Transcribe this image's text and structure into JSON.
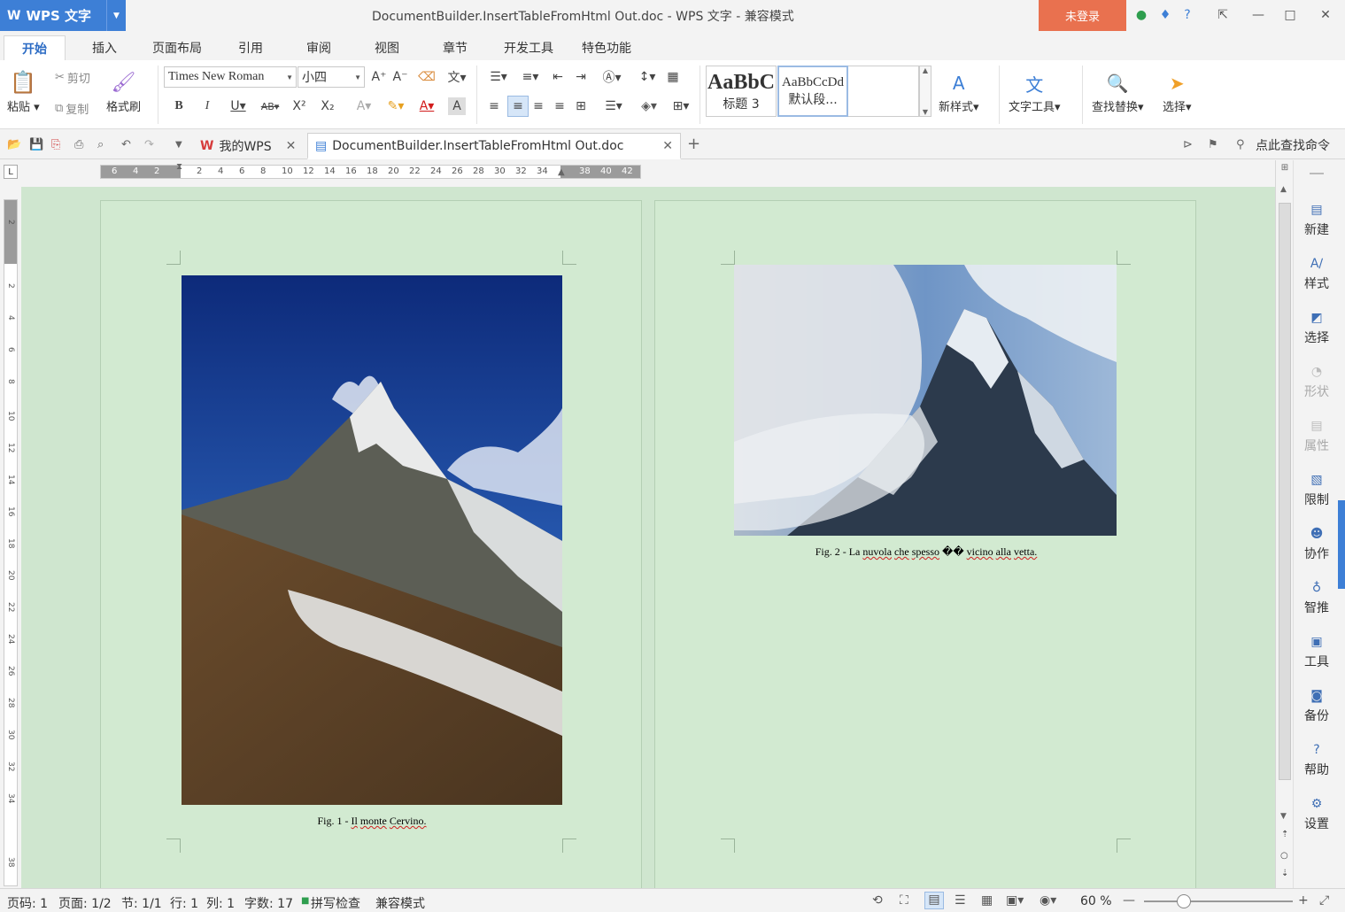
{
  "titlebar": {
    "app_name": "WPS 文字",
    "window_title": "DocumentBuilder.InsertTableFromHtml Out.doc - WPS 文字 - 兼容模式",
    "login_label": "未登录"
  },
  "menu": {
    "tabs": [
      "开始",
      "插入",
      "页面布局",
      "引用",
      "审阅",
      "视图",
      "章节",
      "开发工具",
      "特色功能"
    ],
    "active": "开始"
  },
  "ribbon": {
    "paste": "粘贴",
    "cut": "剪切",
    "copy": "复制",
    "format_painter": "格式刷",
    "font_name": "Times New Roman",
    "font_size": "小四",
    "style_heading_sample": "AaBbC",
    "style_heading_name": "标题 3",
    "style_default_sample": "AaBbCcDd",
    "style_default_name": "默认段...",
    "new_style": "新样式",
    "text_tools": "文字工具",
    "find_replace": "查找替换",
    "select": "选择"
  },
  "tabbar": {
    "home_tab": "我的WPS",
    "doc_tab": "DocumentBuilder.InsertTableFromHtml Out.doc",
    "search_cmd": "点此查找命令"
  },
  "hruler_ticks": [
    "6",
    "4",
    "2",
    "",
    "2",
    "4",
    "6",
    "8",
    "10",
    "12",
    "14",
    "16",
    "18",
    "20",
    "22",
    "24",
    "26",
    "28",
    "30",
    "32",
    "34",
    "",
    "38",
    "40",
    "42"
  ],
  "vruler_ticks": [
    "2",
    "",
    "2",
    "4",
    "6",
    "8",
    "10",
    "12",
    "14",
    "16",
    "18",
    "20",
    "22",
    "24",
    "26",
    "28",
    "30",
    "32",
    "34",
    "",
    "38"
  ],
  "pages": [
    {
      "caption_prefix": "Fig. 1 - ",
      "caption_words": [
        "Il",
        "monte",
        "Cervino."
      ]
    },
    {
      "caption_prefix": "Fig. 2 - ",
      "caption_words": [
        "La",
        "nuvola",
        "che",
        "spesso",
        "��",
        "vicino",
        "alla",
        "vetta."
      ]
    }
  ],
  "sidepanel": [
    {
      "label": "新建",
      "icon": "new-doc-icon",
      "enabled": true
    },
    {
      "label": "样式",
      "icon": "style-icon",
      "enabled": true
    },
    {
      "label": "选择",
      "icon": "select-icon",
      "enabled": true
    },
    {
      "label": "形状",
      "icon": "shape-icon",
      "enabled": false
    },
    {
      "label": "属性",
      "icon": "property-icon",
      "enabled": false
    },
    {
      "label": "限制",
      "icon": "restrict-icon",
      "enabled": true
    },
    {
      "label": "协作",
      "icon": "collab-icon",
      "enabled": true
    },
    {
      "label": "智推",
      "icon": "recommend-icon",
      "enabled": true
    },
    {
      "label": "工具",
      "icon": "toolbox-icon",
      "enabled": true
    },
    {
      "label": "备份",
      "icon": "backup-icon",
      "enabled": true
    },
    {
      "label": "帮助",
      "icon": "help-icon",
      "enabled": true
    },
    {
      "label": "设置",
      "icon": "settings-icon",
      "enabled": true
    }
  ],
  "status": {
    "page_num": "页码: 1",
    "pages": "页面: 1/2",
    "section": "节: 1/1",
    "line": "行: 1",
    "column": "列: 1",
    "word_count": "字数: 17",
    "spell_check": "拼写检查",
    "compat_mode": "兼容模式",
    "zoom": "60 %"
  }
}
